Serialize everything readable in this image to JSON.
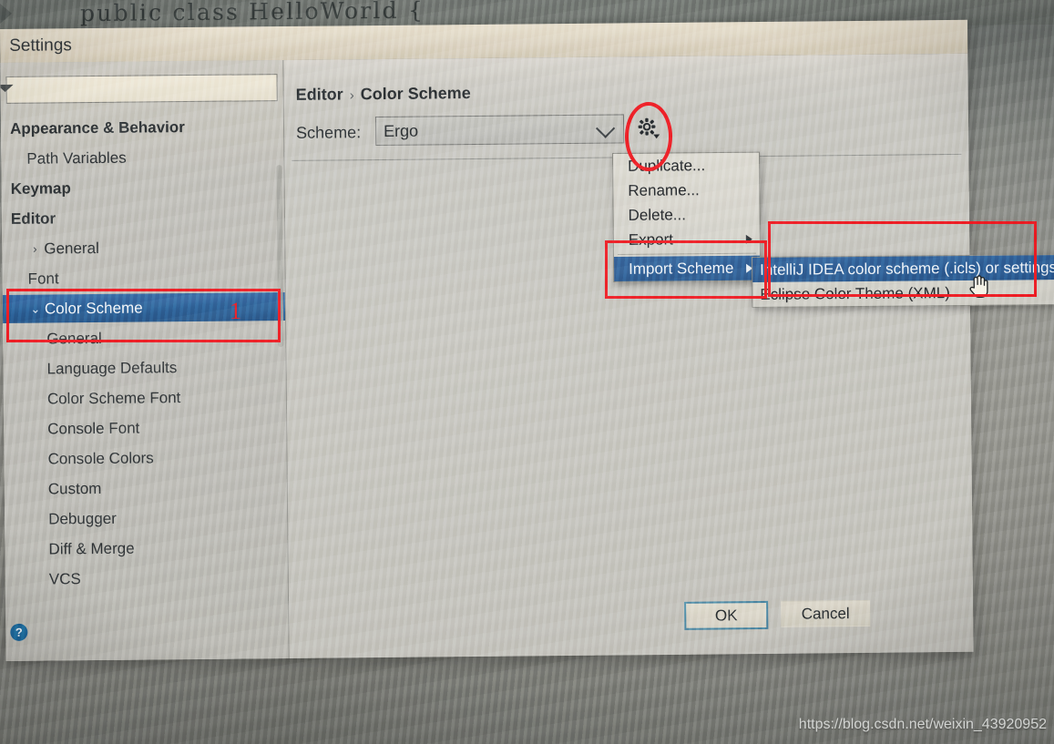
{
  "background": {
    "code_line": "public class HelloWorld {",
    "watermark": "https://blog.csdn.net/weixin_43920952"
  },
  "dialog": {
    "title": "Settings",
    "close_icon": "close-icon",
    "help_icon": "question-mark-icon"
  },
  "sidebar": {
    "search_placeholder": "",
    "search_value": "",
    "items": [
      {
        "label": "Appearance & Behavior",
        "level": 0,
        "bold": true,
        "chevron": "",
        "selected": false
      },
      {
        "label": "Path Variables",
        "level": 1,
        "bold": false,
        "chevron": "",
        "selected": false
      },
      {
        "label": "Keymap",
        "level": 0,
        "bold": true,
        "chevron": "",
        "selected": false
      },
      {
        "label": "Editor",
        "level": 0,
        "bold": true,
        "chevron": "",
        "selected": false
      },
      {
        "label": "General",
        "level": 1,
        "bold": false,
        "chevron": "›",
        "selected": false
      },
      {
        "label": "Font",
        "level": 1,
        "bold": false,
        "chevron": "",
        "selected": false
      },
      {
        "label": "Color Scheme",
        "level": 1,
        "bold": false,
        "chevron": "⌄",
        "selected": true
      },
      {
        "label": "General",
        "level": 2,
        "bold": false,
        "chevron": "",
        "selected": false
      },
      {
        "label": "Language Defaults",
        "level": 2,
        "bold": false,
        "chevron": "",
        "selected": false
      },
      {
        "label": "Color Scheme Font",
        "level": 2,
        "bold": false,
        "chevron": "",
        "selected": false
      },
      {
        "label": "Console Font",
        "level": 2,
        "bold": false,
        "chevron": "",
        "selected": false
      },
      {
        "label": "Console Colors",
        "level": 2,
        "bold": false,
        "chevron": "",
        "selected": false
      },
      {
        "label": "Custom",
        "level": 2,
        "bold": false,
        "chevron": "",
        "selected": false
      },
      {
        "label": "Debugger",
        "level": 2,
        "bold": false,
        "chevron": "",
        "selected": false
      },
      {
        "label": "Diff & Merge",
        "level": 2,
        "bold": false,
        "chevron": "",
        "selected": false
      },
      {
        "label": "VCS",
        "level": 2,
        "bold": false,
        "chevron": "",
        "selected": false
      }
    ]
  },
  "content": {
    "breadcrumb_root": "Editor",
    "breadcrumb_sep": "›",
    "breadcrumb_leaf": "Color Scheme",
    "scheme_label": "Scheme:",
    "scheme_value": "Ergo",
    "gear_icon": "gear-icon",
    "chevron_icon": "chevron-down-icon"
  },
  "menu": {
    "items": [
      {
        "label": "Duplicate...",
        "submenu": false,
        "highlighted": false,
        "separator_after": false
      },
      {
        "label": "Rename...",
        "submenu": false,
        "highlighted": false,
        "separator_after": false
      },
      {
        "label": "Delete...",
        "submenu": false,
        "highlighted": false,
        "separator_after": false
      },
      {
        "label": "Export",
        "submenu": true,
        "highlighted": false,
        "separator_after": true
      },
      {
        "label": "Import Scheme",
        "submenu": true,
        "highlighted": true,
        "separator_after": false
      }
    ]
  },
  "submenu": {
    "items": [
      {
        "label": "IntelliJ IDEA color scheme (.icls) or settings (",
        "highlighted": true
      },
      {
        "label": "Eclipse Color Theme (XML)",
        "highlighted": false
      }
    ],
    "cursor_icon": "hand-pointer-cursor"
  },
  "buttons": {
    "ok": "OK",
    "cancel": "Cancel"
  },
  "annotations": {
    "step_one": "1",
    "accent_color": "#ee1c24",
    "highlight_color": "#2c6299"
  }
}
